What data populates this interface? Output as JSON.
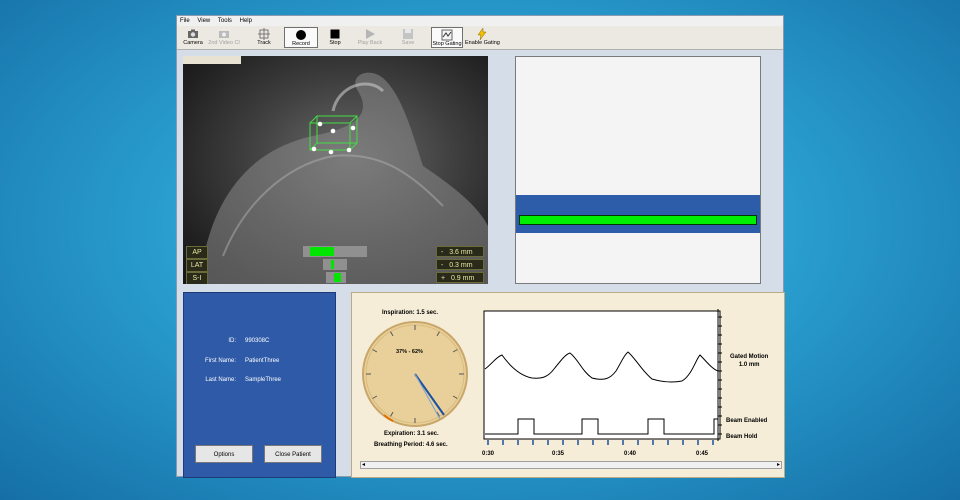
{
  "menu": [
    "File",
    "View",
    "Tools",
    "Help"
  ],
  "toolbar": {
    "camera": "Camera",
    "second_video": "2nd Video Cl",
    "track": "Track",
    "record": "Record",
    "stop": "Stop",
    "play_back": "Play Back",
    "save": "Save",
    "stop_gating": "Stop Gating",
    "enable_gating": "Enable Gating"
  },
  "tracking": {
    "axes": [
      {
        "label": "AP",
        "sign": "-",
        "value": "3.6 mm"
      },
      {
        "label": "LAT",
        "sign": "-",
        "value": "0.3 mm"
      },
      {
        "label": "S-I",
        "sign": "+",
        "value": "0.9 mm"
      }
    ]
  },
  "patient": {
    "id_label": "ID:",
    "id": "990308C",
    "first_name_label": "First Name:",
    "first_name": "PatientThree",
    "last_name_label": "Last Name:",
    "last_name": "SampleThree",
    "options_button": "Options",
    "close_button": "Close Patient"
  },
  "breathing": {
    "inspiration": "Inspiration: 1.5 sec.",
    "window": "37% - 62%",
    "expiration": "Expiration: 3.1 sec.",
    "period": "Breathing Period: 4.6 sec."
  },
  "trace": {
    "gated_motion_label": "Gated Motion",
    "gated_motion_value": "1.0 mm",
    "beam_enabled_label": "Beam Enabled",
    "beam_hold_label": "Beam Hold",
    "time_ticks": [
      "0:30",
      "0:35",
      "0:40",
      "0:45"
    ]
  },
  "colors": {
    "accent_green": "#00e600",
    "panel_blue": "#2f5aa8",
    "gating_bg": "#f6edd8",
    "trace_blue": "#1b4fa0"
  }
}
